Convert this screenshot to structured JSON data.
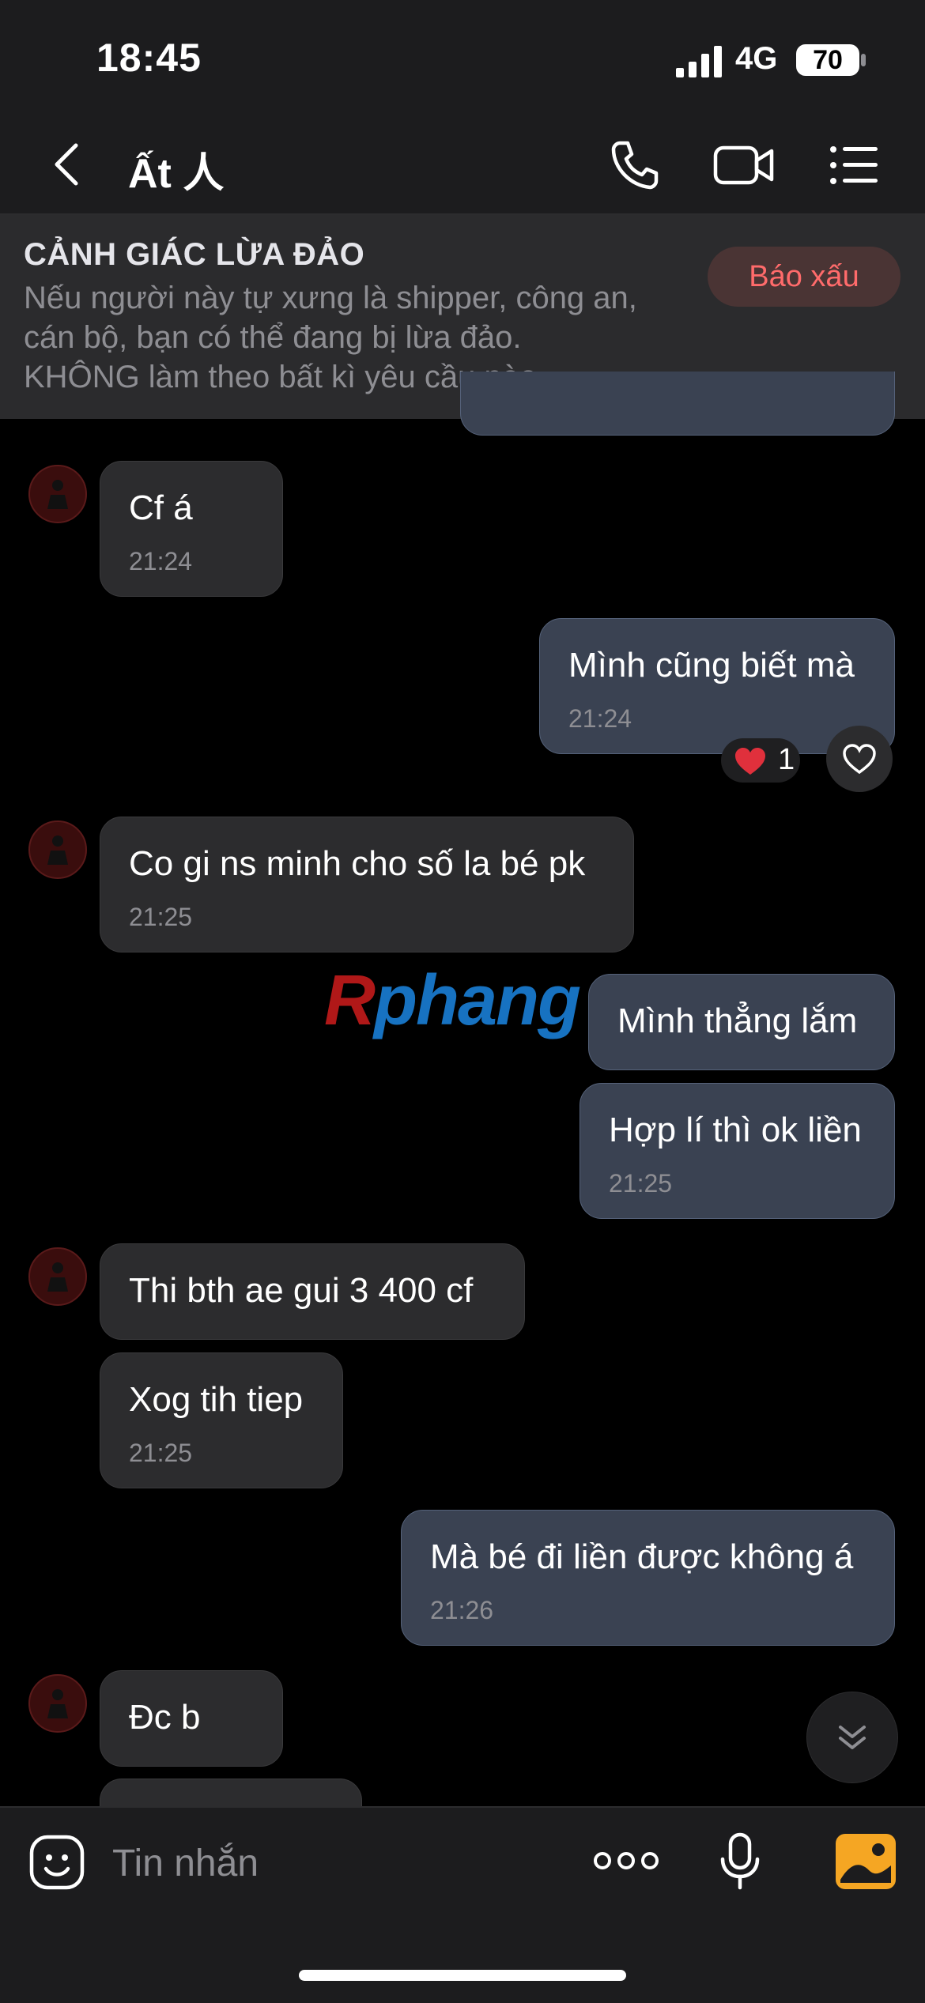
{
  "status_bar": {
    "time": "18:45",
    "network": "4G",
    "battery": "70"
  },
  "header": {
    "title": "Ất 人",
    "icons": [
      "back-icon",
      "phone-icon",
      "video-call-icon",
      "menu-list-icon"
    ]
  },
  "warning": {
    "title": "CẢNH GIÁC LỪA ĐẢO",
    "lines": [
      "Nếu người này tự xưng là shipper, công an,",
      "cán bộ, bạn có thể đang bị lừa đảo.",
      "KHÔNG làm theo bất kì yêu cầu nào."
    ],
    "report_label": "Báo xấu"
  },
  "messages": [
    {
      "side": "in",
      "text": "Cf á",
      "time": "21:24"
    },
    {
      "side": "out",
      "text": "Mình cũng biết mà",
      "time": "21:24",
      "reaction_count": "1"
    },
    {
      "side": "in",
      "text": "Co gi ns minh cho số la bé pk",
      "time": "21:25"
    },
    {
      "side": "out",
      "text": "Mình thẳng lắm",
      "time": ""
    },
    {
      "side": "out",
      "text": "Hợp lí thì ok liền",
      "time": "21:25"
    },
    {
      "side": "in",
      "text": "Thi bth ae gui 3 400 cf",
      "time": ""
    },
    {
      "side": "in",
      "text": "Xog tih tiep",
      "time": "21:25"
    },
    {
      "side": "out",
      "text": "Mà bé đi liền được không á",
      "time": "21:26"
    },
    {
      "side": "in",
      "text": "Đc b",
      "time": ""
    }
  ],
  "watermark": {
    "part1": "R",
    "part2": "phang"
  },
  "input": {
    "placeholder": "Tin nhắn"
  },
  "colors": {
    "background": "#000000",
    "bubble_in": "#2c2c2e",
    "bubble_out": "#3a4252",
    "warning_accent": "#ff6b6b",
    "gallery_icon": "#f5a623"
  }
}
